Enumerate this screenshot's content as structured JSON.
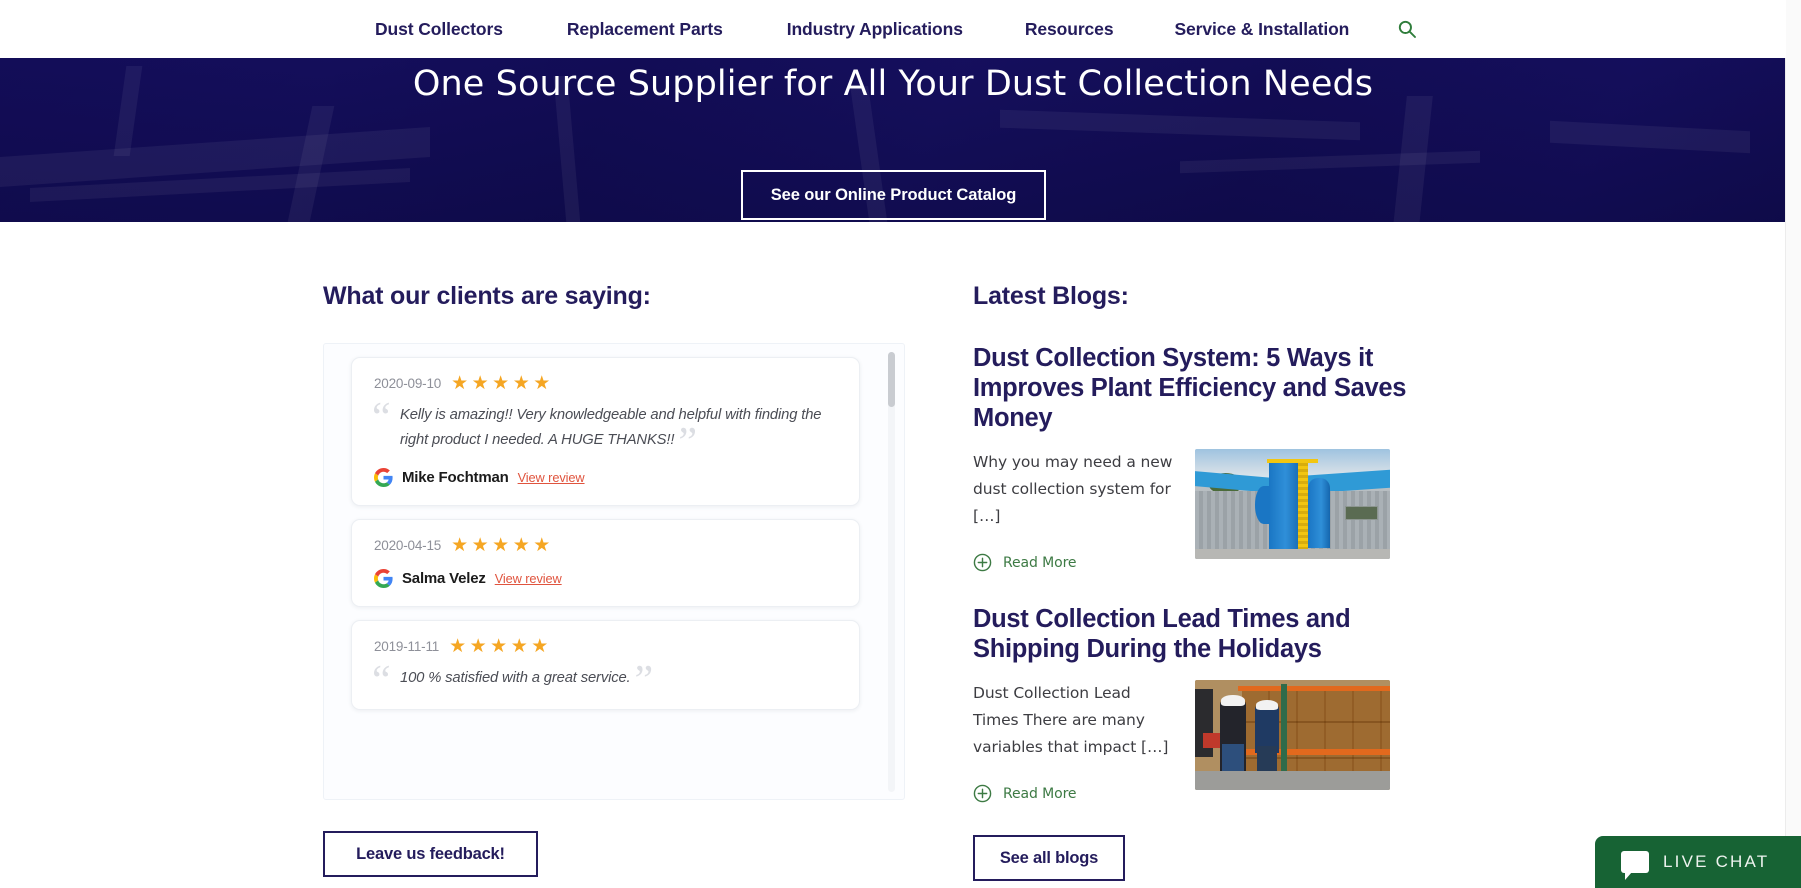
{
  "nav": {
    "items": [
      {
        "label": "Dust Collectors"
      },
      {
        "label": "Replacement Parts"
      },
      {
        "label": "Industry Applications"
      },
      {
        "label": "Resources"
      },
      {
        "label": "Service & Installation"
      }
    ],
    "search_icon": "search-icon"
  },
  "hero": {
    "title": "One Source Supplier for All Your Dust Collection Needs",
    "cta_label": "See our Online Product Catalog"
  },
  "testimonials": {
    "heading": "What our clients are saying:",
    "feedback_button": "Leave us feedback!",
    "link_label": "View review",
    "star_color": "#f5a623",
    "link_color": "#e0543e",
    "reviews": [
      {
        "date": "2020-09-10",
        "stars": 5,
        "text": "Kelly is amazing!! Very knowledgeable and helpful with finding the right product I needed. A HUGE THANKS!!",
        "author": "Mike Fochtman",
        "link": "View review",
        "source_icon": "google-g-icon"
      },
      {
        "date": "2020-04-15",
        "stars": 5,
        "text": "",
        "author": "Salma Velez",
        "link": "View review",
        "source_icon": "google-g-icon"
      },
      {
        "date": "2019-11-11",
        "stars": 5,
        "text": "100 % satisfied with a great service.",
        "author": "",
        "link": "",
        "source_icon": "google-g-icon"
      }
    ]
  },
  "blogs": {
    "heading": "Latest Blogs:",
    "see_all_label": "See all blogs",
    "read_more_label": "Read More",
    "read_more_color": "#3d7a44",
    "posts": [
      {
        "title": "Dust Collection System: 5 Ways it Improves Plant Efficiency and Saves Money",
        "excerpt": "Why you may need a new dust collection system for […]",
        "read_more": "Read More",
        "thumb_alt": "blue-dust-collector-outside-warehouse"
      },
      {
        "title": "Dust Collection Lead Times and Shipping During the Holidays",
        "excerpt": "Dust Collection Lead Times There are many variables that impact […]",
        "read_more": "Read More",
        "thumb_alt": "warehouse-workers-with-pallets"
      }
    ]
  },
  "live_chat": {
    "label": "LIVE CHAT",
    "icon": "chat-bubble-icon",
    "color": "#176334"
  },
  "theme": {
    "navy": "#241c5c",
    "hero_bg": "#0e0a4e",
    "green": "#2f7d3b"
  }
}
